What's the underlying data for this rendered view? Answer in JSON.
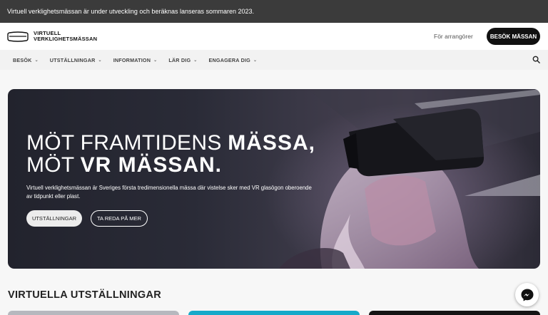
{
  "announcement": "Virtuell verklighetsmässan är under utveckling och beräknas lanseras sommaren 2023.",
  "logo": {
    "line1": "VIRTUELL",
    "line2": "VERKLIGHETSMÄSSAN"
  },
  "header": {
    "organizers_link": "För arrangörer",
    "visit_button": "BESÖK MÄSSAN"
  },
  "nav": [
    {
      "label": "BESÖK"
    },
    {
      "label": "UTSTÄLLNINGAR"
    },
    {
      "label": "INFORMATION"
    },
    {
      "label": "LÄR DIG"
    },
    {
      "label": "ENGAGERA DIG"
    }
  ],
  "hero": {
    "title_line1_light": "MÖT FRAMTIDENS ",
    "title_line1_bold": "MÄSSA,",
    "title_line2_light": "MÖT ",
    "title_line2_bold": "VR MÄSSAN.",
    "description": "Virtuell verklighetsmässan är Sveriges första tredimensionella mässa där vistelse sker med VR glasögon oberoende av tidpunkt eller plast.",
    "primary_button": "UTSTÄLLNINGAR",
    "secondary_button": "TA REDA PÅ MER"
  },
  "section_title": "VIRTUELLA UTSTÄLLNINGAR",
  "icons": [
    "logo-icon",
    "chevron-down-icon",
    "search-icon",
    "messenger-icon"
  ],
  "colors": {
    "announcement_bg": "#3b3b3b",
    "primary_button_bg": "#111111",
    "card2_bg": "#16a9c9"
  }
}
